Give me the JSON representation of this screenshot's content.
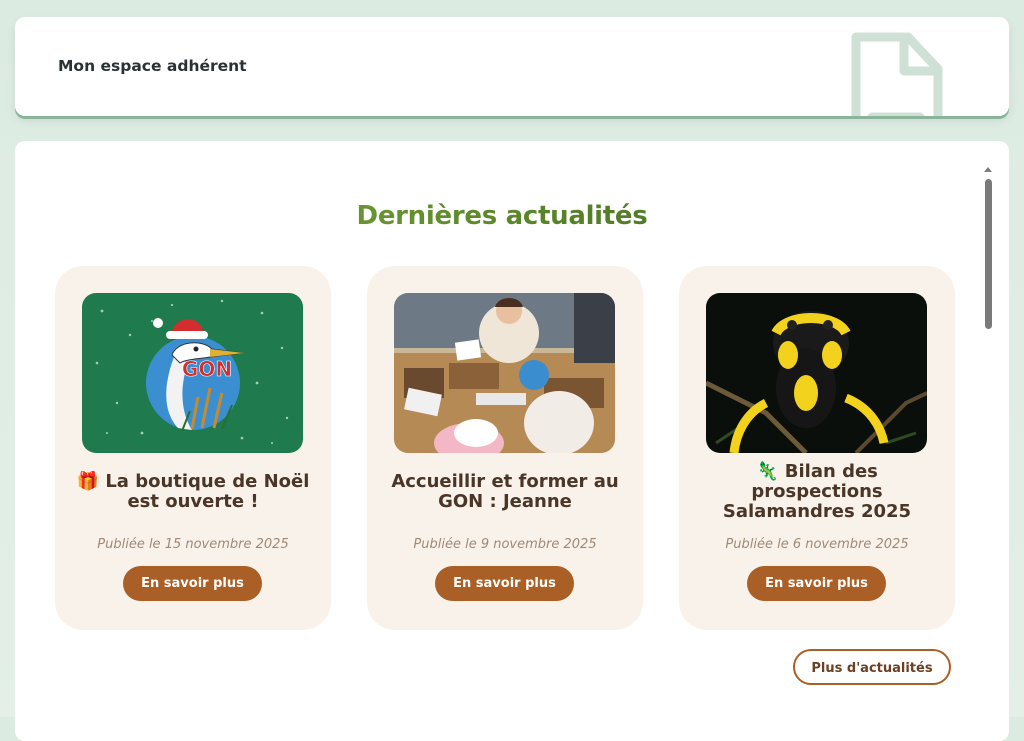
{
  "header": {
    "title": "Mon espace adhérent",
    "icon": "document-icon"
  },
  "news_section": {
    "title": "Dernières actualités",
    "items": [
      {
        "emoji": "🎁",
        "title": "La boutique de Noël est ouverte !",
        "date": "Publiée le 15 novembre 2025",
        "button": "En savoir plus",
        "image": "gon-heron-christmas-logo",
        "image_text": "GON"
      },
      {
        "emoji": "",
        "title": "Accueillir et former au GON : Jeanne",
        "date": "Publiée le 9 novembre 2025",
        "button": "En savoir plus",
        "image": "workshop-photo"
      },
      {
        "emoji": "🦎",
        "title": "Bilan des prospections Salamandres 2025",
        "date": "Publiée le 6 novembre 2025",
        "button": "En savoir plus",
        "image": "salamander-photo"
      }
    ],
    "more_button": "Plus d'actualités"
  },
  "colors": {
    "accent_brown": "#aa5f26",
    "card_bg": "#f8f2ea",
    "title_green": "#5f8c2c",
    "page_bg": "#dcebe2"
  }
}
